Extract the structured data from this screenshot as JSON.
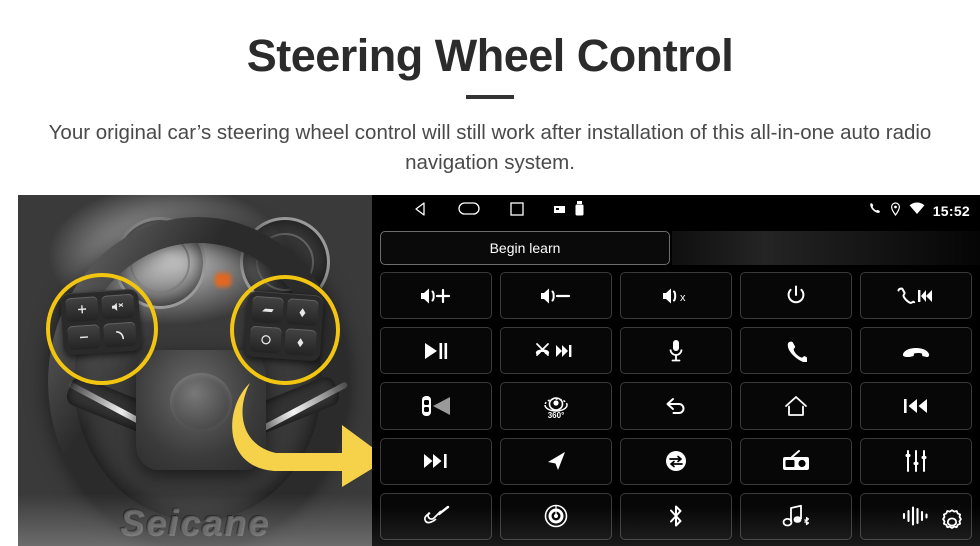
{
  "header": {
    "title": "Steering Wheel Control",
    "subtitle": "Your original car’s steering wheel control will still work after installation of this all-in-one auto radio navigation system."
  },
  "photo": {
    "watermark": "Seicane",
    "highlight_color": "#F2C511",
    "arrow_color": "#F5D24A",
    "left_cluster_buttons": [
      "volume-up-icon",
      "voice-mute-icon",
      "volume-down-icon",
      "phone-icon"
    ],
    "right_cluster_buttons": [
      "cruise-icon",
      "arrow-up-icon",
      "circle-icon",
      "arrow-down-icon"
    ]
  },
  "head_unit": {
    "statusbar": {
      "nav": [
        "back-icon",
        "home-icon",
        "recents-icon",
        "sdcard-icon",
        "usb-icon"
      ],
      "system": [
        "phone-icon",
        "location-icon",
        "wifi-icon"
      ],
      "time": "15:52"
    },
    "learn_button": "Begin learn",
    "settings_label": "gear-icon",
    "keys": [
      {
        "name": "volume-up-key",
        "icon": "volume-up"
      },
      {
        "name": "volume-down-key",
        "icon": "volume-down"
      },
      {
        "name": "mute-key",
        "icon": "volume-mute"
      },
      {
        "name": "power-key",
        "icon": "power"
      },
      {
        "name": "answer-prev-key",
        "icon": "call-prev"
      },
      {
        "name": "play-pause-key",
        "icon": "play-pause"
      },
      {
        "name": "reject-next-key",
        "icon": "call-end-next"
      },
      {
        "name": "microphone-key",
        "icon": "microphone"
      },
      {
        "name": "call-key",
        "icon": "phone"
      },
      {
        "name": "hangup-key",
        "icon": "hangup"
      },
      {
        "name": "rear-camera-key",
        "icon": "car-camera"
      },
      {
        "name": "camera-360-key",
        "icon": "camera-360",
        "label": "360°"
      },
      {
        "name": "back-key",
        "icon": "back-arrow"
      },
      {
        "name": "home-key",
        "icon": "home"
      },
      {
        "name": "previous-track-key",
        "icon": "prev-track"
      },
      {
        "name": "next-track-key",
        "icon": "next-track"
      },
      {
        "name": "navigation-key",
        "icon": "navigation-arrow"
      },
      {
        "name": "mode-swap-key",
        "icon": "mode-swap"
      },
      {
        "name": "radio-key",
        "icon": "radio"
      },
      {
        "name": "equalizer-key",
        "icon": "equalizer"
      },
      {
        "name": "aux-key",
        "icon": "aux-cable"
      },
      {
        "name": "disc-key",
        "icon": "disc"
      },
      {
        "name": "bluetooth-key",
        "icon": "bluetooth"
      },
      {
        "name": "bluetooth-music-key",
        "icon": "bluetooth-music"
      },
      {
        "name": "voice-key",
        "icon": "voice-wave"
      }
    ]
  }
}
